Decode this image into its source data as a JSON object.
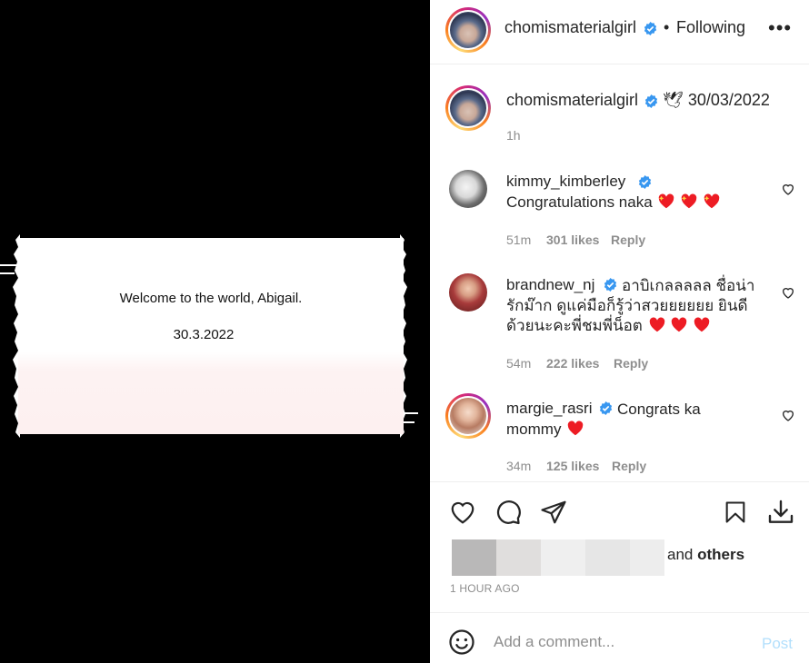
{
  "colors": {
    "background_left": "#000000",
    "verified_blue": "#3897f0",
    "secondary_text": "#8e8e8e",
    "post_button": "#b2dffc",
    "heart_red": "#ed1c24"
  },
  "media": {
    "title": "Welcome to the world, Abigail.",
    "date": "30.3.2022"
  },
  "header": {
    "username": "chomismaterialgirl",
    "separator": "•",
    "follow_status": "Following",
    "more_icon": "more-horizontal-icon"
  },
  "caption": {
    "username": "chomismaterialgirl",
    "text": "🕊 30/03/2022",
    "time": "1h"
  },
  "comments": [
    {
      "username": "kimmy_kimberley",
      "text": "Congratulations naka",
      "emoji": [
        "heart",
        "heart",
        "heart"
      ],
      "time": "51m",
      "likes": "301 likes",
      "reply": "Reply"
    },
    {
      "username": "brandnew_nj",
      "text_line1": "อาบิเกลลลลล ชื่อน่า",
      "text_line2": "รักม๊าก ดูแค่มือก็รู้ว่าสวยยยยยย ยินดี",
      "text_line3": "ด้วยนะคะพี่ชมพี่น็อต",
      "emoji": [
        "heart",
        "heart",
        "heart"
      ],
      "time": "54m",
      "likes": "222 likes",
      "reply": "Reply"
    },
    {
      "username": "margie_rasri",
      "text_line1": "Congrats ka",
      "text_line2": "mommy",
      "emoji": [
        "heart"
      ],
      "time": "34m",
      "likes": "125 likes",
      "reply": "Reply"
    }
  ],
  "actions": {
    "like_icon": "heart-icon",
    "comment_icon": "comment-icon",
    "share_icon": "send-icon",
    "save_icon": "bookmark-icon",
    "download_icon": "download-icon"
  },
  "likes_summary": {
    "and_text": "and",
    "others_text": "others"
  },
  "timestamp": "1 HOUR AGO",
  "comment_box": {
    "placeholder": "Add a comment...",
    "post_label": "Post"
  }
}
